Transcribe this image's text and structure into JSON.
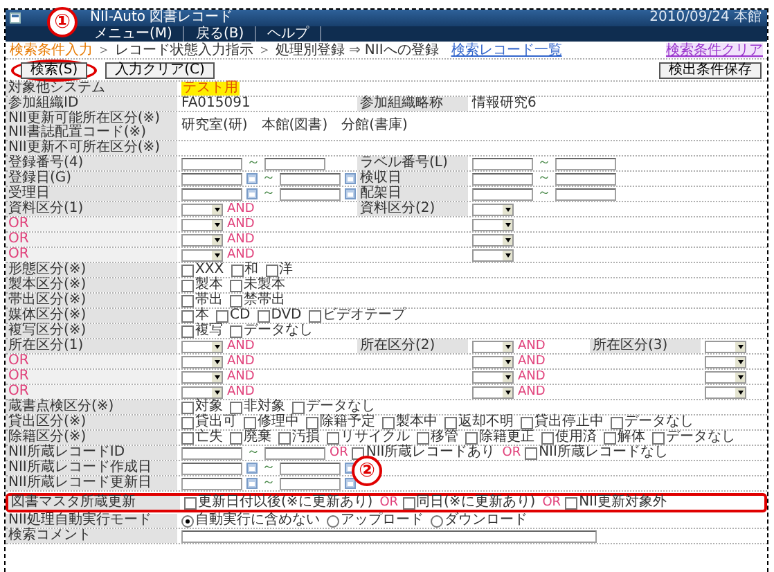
{
  "window": {
    "title": "NII-Auto 図書レコード",
    "date": "2010/09/24 本館"
  },
  "menu": [
    {
      "label": "メニュー(M)"
    },
    {
      "label": "戻る(B)"
    },
    {
      "label": "ヘルプ"
    }
  ],
  "breadcrumb": {
    "items": [
      {
        "kind": "step",
        "text": "検索条件入力",
        "current": true
      },
      {
        "kind": "sep",
        "text": "＞"
      },
      {
        "kind": "step",
        "text": "レコード状態入力指示",
        "current": false
      },
      {
        "kind": "sep",
        "text": "＞"
      },
      {
        "kind": "step",
        "text": "処理別登録",
        "current": false
      },
      {
        "kind": "sep",
        "text": "⇒"
      },
      {
        "kind": "step",
        "text": "NIIへの登録",
        "current": false
      }
    ],
    "link": "検索レコード一覧",
    "clear_link": "検索条件クリア"
  },
  "toolbar": {
    "buttons": [
      {
        "label": "検索(S)",
        "circled": true
      },
      {
        "label": "入力クリア(C)",
        "circled": false
      }
    ],
    "save_button": "検出条件保存"
  },
  "rows": [
    {
      "cells": [
        {
          "label": "対象他システム",
          "parts": [
            {
              "kind": "badge",
              "text": "テスト用"
            }
          ]
        }
      ]
    },
    {
      "cells": [
        {
          "label": "参加組織ID",
          "parts": [
            {
              "kind": "text",
              "text": "FA015091"
            }
          ]
        },
        {
          "label": "参加組織略称",
          "parts": [
            {
              "kind": "text",
              "text": "情報研究6"
            }
          ]
        }
      ]
    },
    {
      "cells": [
        {
          "label": "NII更新可能所在区分(※)",
          "label2": "NII書誌配置コード(※)",
          "parts": [
            {
              "kind": "text",
              "text": "研究室(研)　本館(図書)　分館(書庫)"
            }
          ]
        }
      ]
    },
    {
      "cells": [
        {
          "label": "NII更新不可所在区分(※)"
        }
      ]
    },
    {
      "cells": [
        {
          "label": "登録番号(4)",
          "parts": [
            {
              "kind": "input"
            },
            {
              "kind": "tilde",
              "text": "～"
            },
            {
              "kind": "input"
            }
          ]
        },
        {
          "label": "ラベル番号(L)",
          "parts": [
            {
              "kind": "input"
            },
            {
              "kind": "tilde",
              "text": "～"
            },
            {
              "kind": "input"
            }
          ]
        }
      ]
    },
    {
      "cells": [
        {
          "label": "登録日(G)",
          "parts": [
            {
              "kind": "date"
            },
            {
              "kind": "tilde",
              "text": "～"
            },
            {
              "kind": "date"
            }
          ]
        },
        {
          "label": "検収日",
          "parts": [
            {
              "kind": "input"
            },
            {
              "kind": "tilde",
              "text": "～"
            },
            {
              "kind": "input"
            }
          ]
        }
      ]
    },
    {
      "cells": [
        {
          "label": "受理日",
          "parts": [
            {
              "kind": "date"
            },
            {
              "kind": "tilde",
              "text": "～"
            },
            {
              "kind": "date"
            }
          ]
        },
        {
          "label": "配架日",
          "parts": [
            {
              "kind": "input"
            },
            {
              "kind": "tilde",
              "text": "～"
            },
            {
              "kind": "input"
            }
          ]
        }
      ]
    },
    {
      "cells": [
        {
          "label": "資料区分(1)",
          "parts": [
            {
              "kind": "select"
            },
            {
              "kind": "and",
              "text": "AND"
            }
          ]
        },
        {
          "label": "資料区分(2)",
          "parts": [
            {
              "kind": "select"
            }
          ]
        }
      ]
    },
    {
      "cells": [
        {
          "label": "OR",
          "connector": true,
          "parts": [
            {
              "kind": "select"
            },
            {
              "kind": "and",
              "text": "AND"
            }
          ]
        },
        {
          "parts": [
            {
              "kind": "select"
            }
          ]
        }
      ]
    },
    {
      "cells": [
        {
          "label": "OR",
          "connector": true,
          "parts": [
            {
              "kind": "select"
            },
            {
              "kind": "and",
              "text": "AND"
            }
          ]
        },
        {
          "parts": [
            {
              "kind": "select"
            }
          ]
        }
      ]
    },
    {
      "cells": [
        {
          "label": "OR",
          "connector": true,
          "parts": [
            {
              "kind": "select"
            },
            {
              "kind": "and",
              "text": "AND"
            }
          ]
        },
        {
          "parts": [
            {
              "kind": "select"
            }
          ]
        }
      ]
    },
    {
      "cells": [
        {
          "label": "形態区分(※)",
          "parts": [
            {
              "kind": "check",
              "label": "XXX",
              "checked": false
            },
            {
              "kind": "check",
              "label": "和",
              "checked": false
            },
            {
              "kind": "check",
              "label": "洋",
              "checked": false
            }
          ]
        }
      ]
    },
    {
      "cells": [
        {
          "label": "製本区分(※)",
          "parts": [
            {
              "kind": "check",
              "label": "製本",
              "checked": false
            },
            {
              "kind": "check",
              "label": "未製本",
              "checked": false
            }
          ]
        }
      ]
    },
    {
      "cells": [
        {
          "label": "帯出区分(※)",
          "parts": [
            {
              "kind": "check",
              "label": "帯出",
              "checked": false
            },
            {
              "kind": "check",
              "label": "禁帯出",
              "checked": false
            }
          ]
        }
      ]
    },
    {
      "cells": [
        {
          "label": "媒体区分(※)",
          "parts": [
            {
              "kind": "check",
              "label": "本",
              "checked": false
            },
            {
              "kind": "check",
              "label": "CD",
              "checked": false
            },
            {
              "kind": "check",
              "label": "DVD",
              "checked": false
            },
            {
              "kind": "check",
              "label": "ビデオテープ",
              "checked": false
            }
          ]
        }
      ]
    },
    {
      "cells": [
        {
          "label": "複写区分(※)",
          "parts": [
            {
              "kind": "check",
              "label": "複写",
              "checked": false
            },
            {
              "kind": "check",
              "label": "データなし",
              "checked": false
            }
          ]
        }
      ]
    },
    {
      "cells": [
        {
          "label": "所在区分(1)",
          "parts": [
            {
              "kind": "select"
            },
            {
              "kind": "and",
              "text": "AND"
            }
          ]
        },
        {
          "label": "所在区分(2)",
          "parts": [
            {
              "kind": "select"
            },
            {
              "kind": "and",
              "text": "AND"
            }
          ]
        },
        {
          "label": "所在区分(3)",
          "parts": [
            {
              "kind": "select"
            }
          ]
        }
      ]
    },
    {
      "cells": [
        {
          "label": "OR",
          "connector": true,
          "parts": [
            {
              "kind": "select"
            },
            {
              "kind": "and",
              "text": "AND"
            }
          ]
        },
        {
          "parts": [
            {
              "kind": "select"
            },
            {
              "kind": "and",
              "text": "AND"
            }
          ]
        },
        {
          "parts": [
            {
              "kind": "select"
            }
          ]
        }
      ]
    },
    {
      "cells": [
        {
          "label": "OR",
          "connector": true,
          "parts": [
            {
              "kind": "select"
            },
            {
              "kind": "and",
              "text": "AND"
            }
          ]
        },
        {
          "parts": [
            {
              "kind": "select"
            },
            {
              "kind": "and",
              "text": "AND"
            }
          ]
        },
        {
          "parts": [
            {
              "kind": "select"
            }
          ]
        }
      ]
    },
    {
      "cells": [
        {
          "label": "OR",
          "connector": true,
          "parts": [
            {
              "kind": "select"
            },
            {
              "kind": "and",
              "text": "AND"
            }
          ]
        },
        {
          "parts": [
            {
              "kind": "select"
            },
            {
              "kind": "and",
              "text": "AND"
            }
          ]
        },
        {
          "parts": [
            {
              "kind": "select"
            }
          ]
        }
      ]
    },
    {
      "cells": [
        {
          "label": "蔵書点検区分(※)",
          "parts": [
            {
              "kind": "check",
              "label": "対象",
              "checked": false
            },
            {
              "kind": "check",
              "label": "非対象",
              "checked": false
            },
            {
              "kind": "check",
              "label": "データなし",
              "checked": false
            }
          ]
        }
      ]
    },
    {
      "cells": [
        {
          "label": "貸出区分(※)",
          "parts": [
            {
              "kind": "check",
              "label": "貸出可",
              "checked": false
            },
            {
              "kind": "check",
              "label": "修理中",
              "checked": false
            },
            {
              "kind": "check",
              "label": "除籍予定",
              "checked": false
            },
            {
              "kind": "check",
              "label": "製本中",
              "checked": false
            },
            {
              "kind": "check",
              "label": "返却不明",
              "checked": false
            },
            {
              "kind": "check",
              "label": "貸出停止中",
              "checked": false
            },
            {
              "kind": "check",
              "label": "データなし",
              "checked": false
            }
          ]
        }
      ]
    },
    {
      "cells": [
        {
          "label": "除籍区分(※)",
          "parts": [
            {
              "kind": "check",
              "label": "亡失",
              "checked": false
            },
            {
              "kind": "check",
              "label": "廃棄",
              "checked": false
            },
            {
              "kind": "check",
              "label": "汚損",
              "checked": false
            },
            {
              "kind": "check",
              "label": "リサイクル",
              "checked": false
            },
            {
              "kind": "check",
              "label": "移管",
              "checked": false
            },
            {
              "kind": "check",
              "label": "除籍更正",
              "checked": false
            },
            {
              "kind": "check",
              "label": "使用済",
              "checked": false
            },
            {
              "kind": "check",
              "label": "解体",
              "checked": false
            },
            {
              "kind": "check",
              "label": "データなし",
              "checked": false
            }
          ]
        }
      ]
    },
    {
      "cells": [
        {
          "label": "NII所蔵レコードID",
          "parts": [
            {
              "kind": "input"
            },
            {
              "kind": "tilde",
              "text": "～"
            },
            {
              "kind": "input"
            },
            {
              "kind": "or",
              "text": "OR"
            },
            {
              "kind": "check",
              "label": "NII所蔵レコードあり",
              "checked": false
            },
            {
              "kind": "or",
              "text": "OR"
            },
            {
              "kind": "check",
              "label": "NII所蔵レコードなし",
              "checked": false
            }
          ]
        }
      ]
    },
    {
      "cells": [
        {
          "label": "NII所蔵レコード作成日",
          "parts": [
            {
              "kind": "date"
            },
            {
              "kind": "tilde",
              "text": "～"
            },
            {
              "kind": "date"
            }
          ]
        }
      ]
    },
    {
      "cells": [
        {
          "label": "NII所蔵レコード更新日",
          "parts": [
            {
              "kind": "date"
            },
            {
              "kind": "tilde",
              "text": "～"
            },
            {
              "kind": "date"
            }
          ]
        }
      ]
    },
    {
      "marked": true,
      "cells": [
        {
          "label": "図書マスタ所蔵更新",
          "parts": [
            {
              "kind": "check",
              "label": "更新日付以後(※に更新あり)",
              "checked": false
            },
            {
              "kind": "or",
              "text": "OR"
            },
            {
              "kind": "check",
              "label": "同日(※に更新あり)",
              "checked": false
            },
            {
              "kind": "or",
              "text": "OR"
            },
            {
              "kind": "check",
              "label": "NII更新対象外",
              "checked": false
            }
          ]
        }
      ]
    },
    {
      "cells": [
        {
          "label": "NII処理自動実行モード",
          "parts": [
            {
              "kind": "radio",
              "label": "自動実行に含めない",
              "selected": true
            },
            {
              "kind": "radio",
              "label": "アップロード",
              "selected": false
            },
            {
              "kind": "radio",
              "label": "ダウンロード",
              "selected": false
            }
          ]
        }
      ]
    },
    {
      "cells": [
        {
          "label": "検索コメント",
          "parts": [
            {
              "kind": "wide-input"
            }
          ]
        }
      ]
    }
  ],
  "callouts": [
    {
      "text": "①"
    },
    {
      "text": "②"
    }
  ]
}
